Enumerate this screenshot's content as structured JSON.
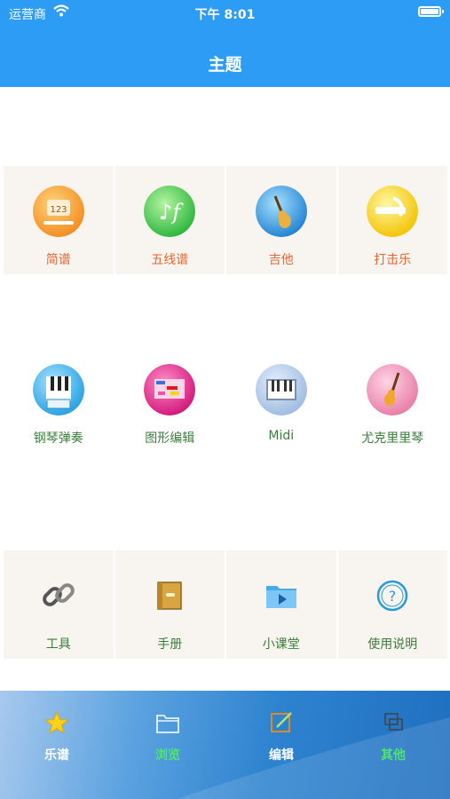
{
  "status": {
    "carrier": "运营商",
    "time": "下午 8:01"
  },
  "header": {
    "title": "主题"
  },
  "rows": [
    {
      "items": [
        {
          "label": "简谱",
          "icon": "jianpu-icon",
          "color": "#e8652f"
        },
        {
          "label": "五线谱",
          "icon": "staff-icon",
          "color": "#e8652f"
        },
        {
          "label": "吉他",
          "icon": "guitar-icon",
          "color": "#e8652f"
        },
        {
          "label": "打击乐",
          "icon": "percussion-icon",
          "color": "#e8652f"
        }
      ]
    },
    {
      "items": [
        {
          "label": "钢琴弹奏",
          "icon": "piano-play-icon",
          "color": "#3a7d3a"
        },
        {
          "label": "图形编辑",
          "icon": "graphic-edit-icon",
          "color": "#3a7d3a"
        },
        {
          "label": "Midi",
          "icon": "midi-icon",
          "color": "#3a7d3a"
        },
        {
          "label": "尤克里里琴",
          "icon": "ukulele-icon",
          "color": "#3a7d3a"
        }
      ]
    },
    {
      "items": [
        {
          "label": "工具",
          "icon": "chain-link-icon",
          "color": "#3a7d3a"
        },
        {
          "label": "手册",
          "icon": "book-icon",
          "color": "#3a7d3a"
        },
        {
          "label": "小课堂",
          "icon": "video-folder-icon",
          "color": "#3a7d3a"
        },
        {
          "label": "使用说明",
          "icon": "question-icon",
          "color": "#3a7d3a"
        }
      ]
    }
  ],
  "tabs": [
    {
      "label": "乐谱",
      "icon": "star-icon",
      "color": "#ffffff"
    },
    {
      "label": "浏览",
      "icon": "folder-icon",
      "color": "#4ee66b"
    },
    {
      "label": "编辑",
      "icon": "edit-icon",
      "color": "#ffffff"
    },
    {
      "label": "其他",
      "icon": "windows-icon",
      "color": "#4ee66b"
    }
  ]
}
